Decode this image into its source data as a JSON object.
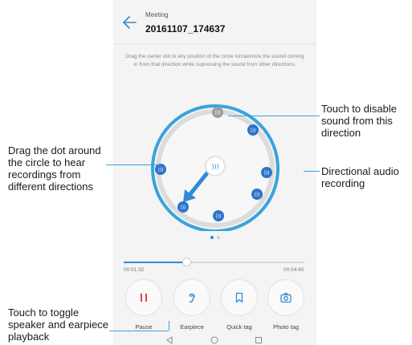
{
  "header": {
    "subtitle": "Meeting",
    "recording_name": "20161107_174637"
  },
  "instructions": "Drag the center dot to any position of the circle tomaximize the sound coming in from that direction while supressing the sound from other directions.",
  "player": {
    "elapsed": "00:01:32",
    "total": "00:04:40",
    "progress_fraction": 0.35
  },
  "pager": {
    "pages": 2,
    "active": 0
  },
  "controls": [
    {
      "id": "pause",
      "label": "Pause",
      "icon": "pause-icon"
    },
    {
      "id": "earpiece",
      "label": "Earpiece",
      "icon": "ear-icon"
    },
    {
      "id": "quick-tag",
      "label": "Quick tag",
      "icon": "bookmark-icon"
    },
    {
      "id": "photo-tag",
      "label": "Photo tag",
      "icon": "camera-icon"
    }
  ],
  "nav": [
    "back-triangle-icon",
    "home-circle-icon",
    "recents-square-icon"
  ],
  "callouts": {
    "disable_sound": "Touch to disable sound from this direction",
    "directional": "Directional audio recording",
    "drag_dot": "Drag the dot around the circle to hear recordings from different directions",
    "toggle_speaker": "Touch to toggle speaker and earpiece playback"
  },
  "colors": {
    "accent": "#2e8bd8",
    "pause_red": "#e0404a",
    "disabled_node": "#9e9e9e",
    "leader_line": "#3aa3d9"
  }
}
